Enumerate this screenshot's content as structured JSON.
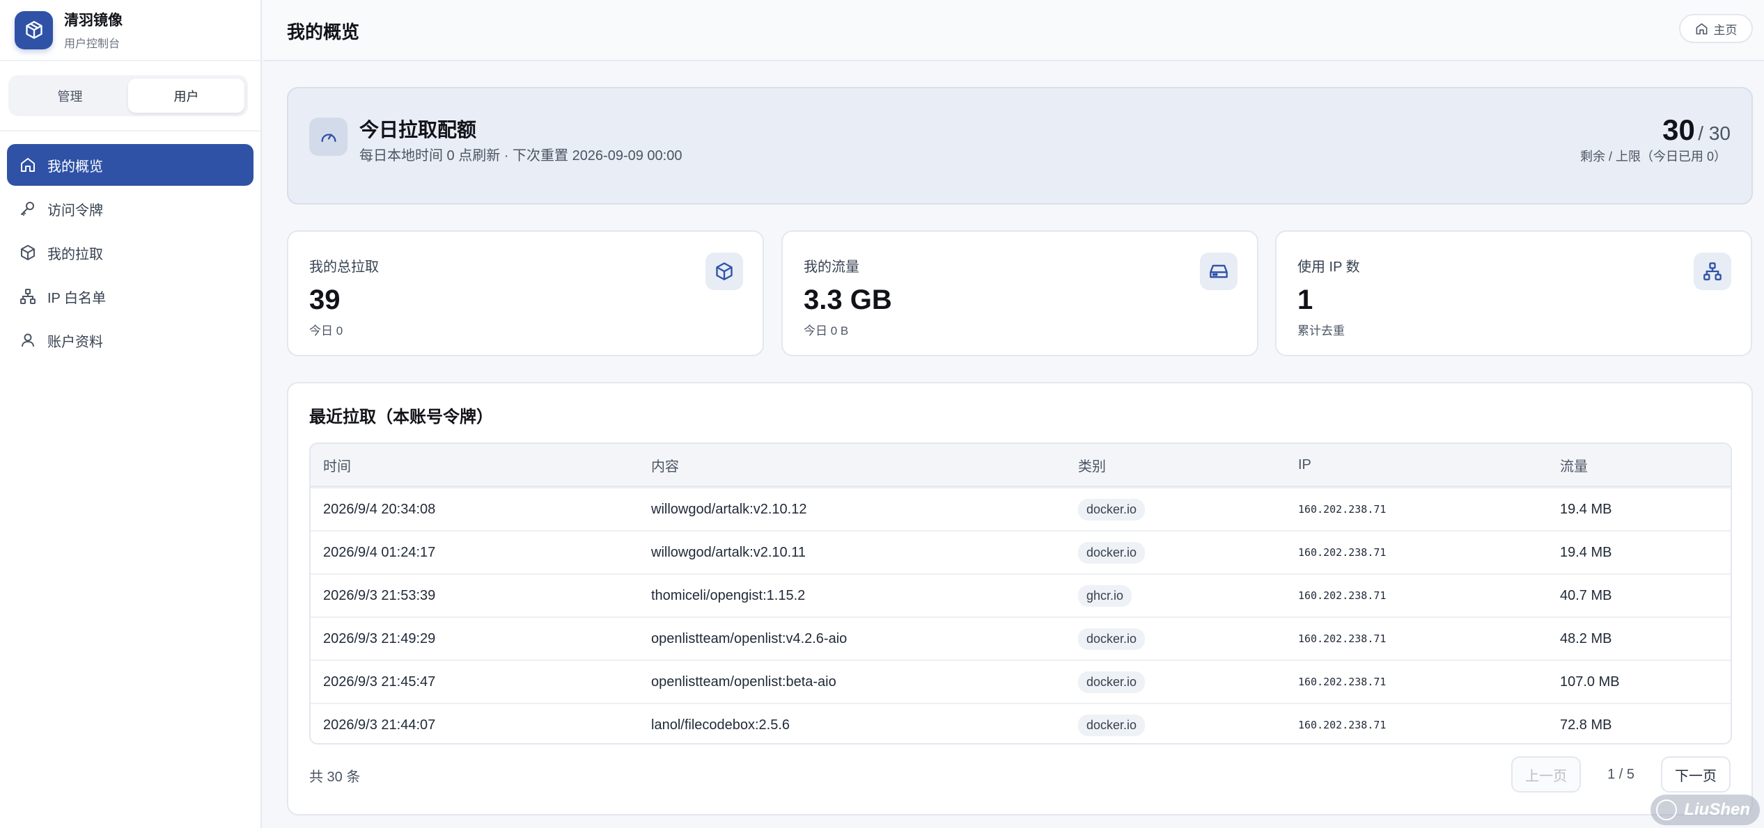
{
  "brand": {
    "title": "清羽镜像",
    "subtitle": "用户控制台"
  },
  "role_switch": {
    "admin": "管理",
    "user": "用户",
    "active": "用户"
  },
  "nav": [
    {
      "label": "我的概览",
      "icon": "home-icon",
      "active": true
    },
    {
      "label": "访问令牌",
      "icon": "key-icon",
      "active": false
    },
    {
      "label": "我的拉取",
      "icon": "package-icon",
      "active": false
    },
    {
      "label": "IP 白名单",
      "icon": "network-icon",
      "active": false
    },
    {
      "label": "账户资料",
      "icon": "user-icon",
      "active": false
    }
  ],
  "header": {
    "title": "我的概览",
    "home_label": "主页"
  },
  "quota": {
    "title": "今日拉取配额",
    "subtitle": "每日本地时间 0 点刷新 · 下次重置 2026-09-09 00:00",
    "remaining": "30",
    "limit": "/ 30",
    "note": "剩余 / 上限（今日已用 0）"
  },
  "stats": [
    {
      "label": "我的总拉取",
      "value": "39",
      "sub": "今日 0",
      "icon": "package-icon"
    },
    {
      "label": "我的流量",
      "value": "3.3 GB",
      "sub": "今日 0 B",
      "icon": "drive-icon"
    },
    {
      "label": "使用 IP 数",
      "value": "1",
      "sub": "累计去重",
      "icon": "network-icon"
    }
  ],
  "recent": {
    "title": "最近拉取（本账号令牌）",
    "columns": [
      "时间",
      "内容",
      "类别",
      "IP",
      "流量"
    ],
    "rows": [
      [
        "2026/9/4 20:34:08",
        "willowgod/artalk:v2.10.12",
        "docker.io",
        "160.202.238.71",
        "19.4 MB"
      ],
      [
        "2026/9/4 01:24:17",
        "willowgod/artalk:v2.10.11",
        "docker.io",
        "160.202.238.71",
        "19.4 MB"
      ],
      [
        "2026/9/3 21:53:39",
        "thomiceli/opengist:1.15.2",
        "ghcr.io",
        "160.202.238.71",
        "40.7 MB"
      ],
      [
        "2026/9/3 21:49:29",
        "openlistteam/openlist:v4.2.6-aio",
        "docker.io",
        "160.202.238.71",
        "48.2 MB"
      ],
      [
        "2026/9/3 21:45:47",
        "openlistteam/openlist:beta-aio",
        "docker.io",
        "160.202.238.71",
        "107.0 MB"
      ],
      [
        "2026/9/3 21:44:07",
        "lanol/filecodebox:2.5.6",
        "docker.io",
        "160.202.238.71",
        "72.8 MB"
      ]
    ],
    "total": "共 30 条",
    "pager": {
      "prev": "上一页",
      "info": "1 / 5",
      "next": "下一页"
    }
  },
  "watermark": "LiuShen",
  "colors": {
    "accent": "#2f52a6",
    "background": "#f5f7fb"
  }
}
